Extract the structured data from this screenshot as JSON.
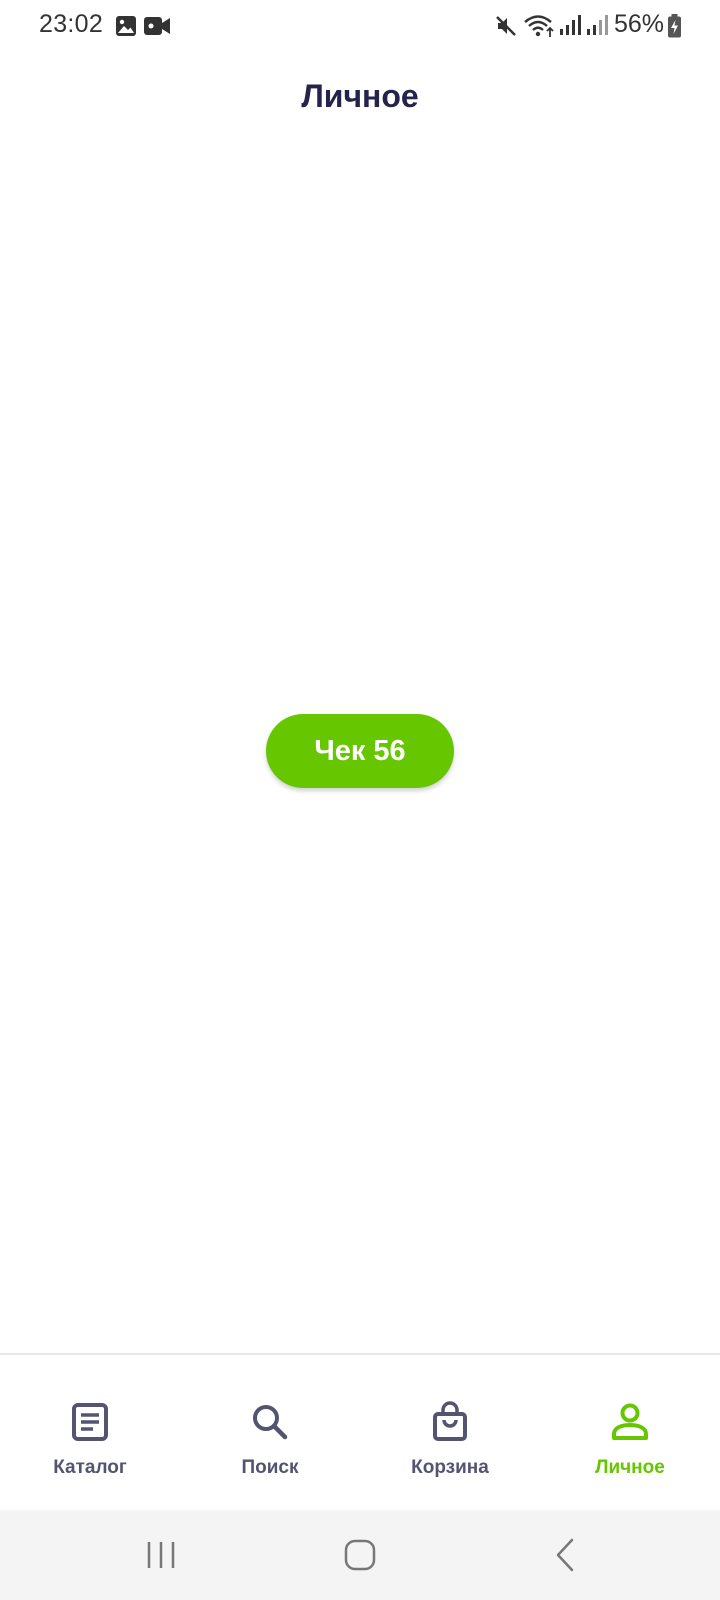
{
  "status_bar": {
    "time": "23:02",
    "battery_percent": "56%",
    "icons": [
      "image-icon",
      "video-camera-icon",
      "mute-icon",
      "wifi-icon",
      "signal-icon",
      "signal-icon-2",
      "battery-charging-icon"
    ]
  },
  "header": {
    "title": "Личное"
  },
  "main": {
    "check_button_label": "Чек 56"
  },
  "bottom_nav": {
    "items": [
      {
        "label": "Каталог",
        "icon": "catalog-icon",
        "active": false
      },
      {
        "label": "Поиск",
        "icon": "search-icon",
        "active": false
      },
      {
        "label": "Корзина",
        "icon": "shopping-bag-icon",
        "active": false
      },
      {
        "label": "Личное",
        "icon": "user-icon",
        "active": true
      }
    ]
  },
  "system_nav": {
    "buttons": [
      "recent-apps-icon",
      "home-icon",
      "back-icon"
    ]
  },
  "colors": {
    "accent": "#66c700",
    "title": "#25234a",
    "nav_inactive": "#545472",
    "system_nav_bg": "#f4f4f4"
  }
}
